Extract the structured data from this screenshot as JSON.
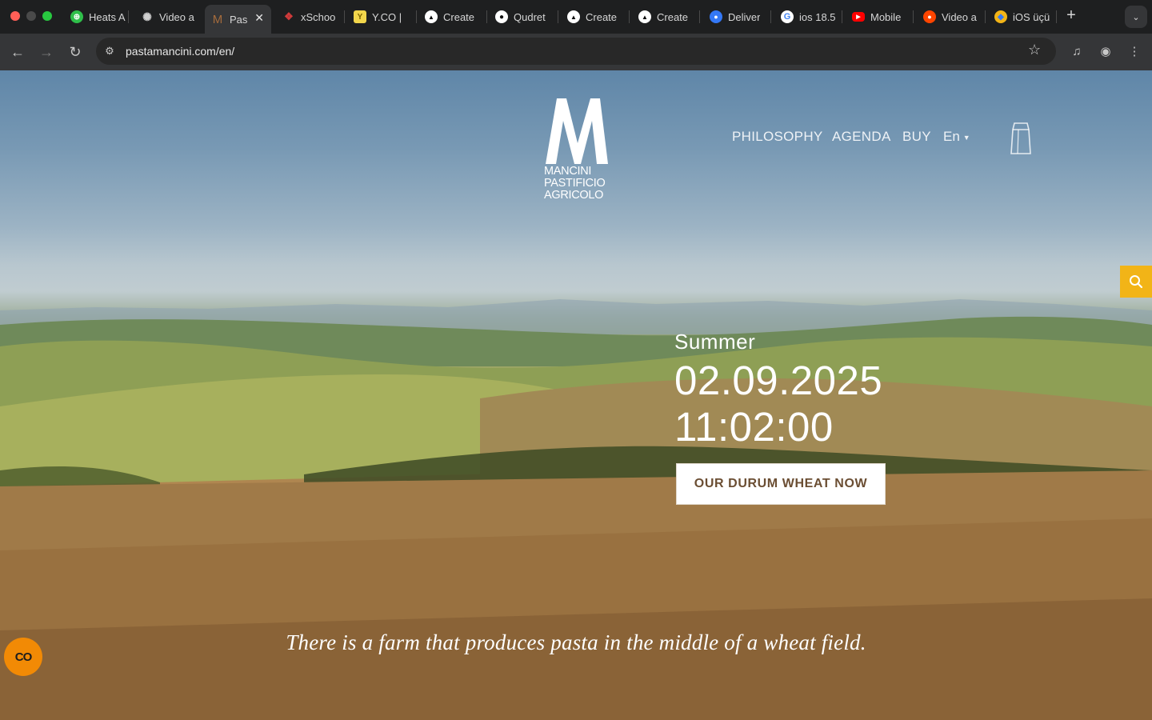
{
  "browser": {
    "tabs": [
      {
        "label": "Heats A",
        "icon": "globe-icon",
        "color": "#2fbf4a"
      },
      {
        "label": "Video a",
        "icon": "openai-icon",
        "color": "#cfcfcf"
      },
      {
        "label": "Pas",
        "icon": "mancini-m-icon",
        "color": "#a46b3c",
        "active": true
      },
      {
        "label": "xSchoo",
        "icon": "xschool-icon",
        "color": "#d23b3b"
      },
      {
        "label": "Y.CO |",
        "icon": "yco-icon",
        "color": "#f2d64b"
      },
      {
        "label": "Create",
        "icon": "vercel-icon",
        "color": "#ffffff"
      },
      {
        "label": "Qudret",
        "icon": "github-icon",
        "color": "#ffffff"
      },
      {
        "label": "Create",
        "icon": "vercel-icon",
        "color": "#ffffff"
      },
      {
        "label": "Create",
        "icon": "vercel-icon",
        "color": "#ffffff"
      },
      {
        "label": "Deliver",
        "icon": "apple-icon",
        "color": "#3478f6"
      },
      {
        "label": "ios 18.5",
        "icon": "google-icon",
        "color": "#ffffff"
      },
      {
        "label": "Mobile",
        "icon": "youtube-icon",
        "color": "#ff0000"
      },
      {
        "label": "Video a",
        "icon": "reddit-icon",
        "color": "#ff4500"
      },
      {
        "label": "iOS üçü",
        "icon": "app-icon",
        "color": "#f2b417"
      }
    ],
    "active_tab_close": "✕",
    "new_tab_symbol": "+",
    "url": "pastamancini.com/en/"
  },
  "site": {
    "logo": {
      "line1": "MANCINI",
      "line2": "PASTIFICIO",
      "line3": "AGRICOLO"
    },
    "nav": {
      "philosophy": "PHILOSOPHY",
      "agenda": "AGENDA",
      "buy": "BUY",
      "language": "En"
    },
    "hero": {
      "season": "Summer",
      "date": "02.09.2025",
      "time": "11:02:00",
      "cta_label": "OUR DURUM WHEAT NOW"
    },
    "tagline": "There is a farm that produces pasta in the middle of  a wheat field.",
    "cookie_button_label": "CO",
    "colors": {
      "cta_text": "#6b4e33",
      "search_accent": "#f2b417",
      "cookie_accent": "#f28a05"
    }
  }
}
